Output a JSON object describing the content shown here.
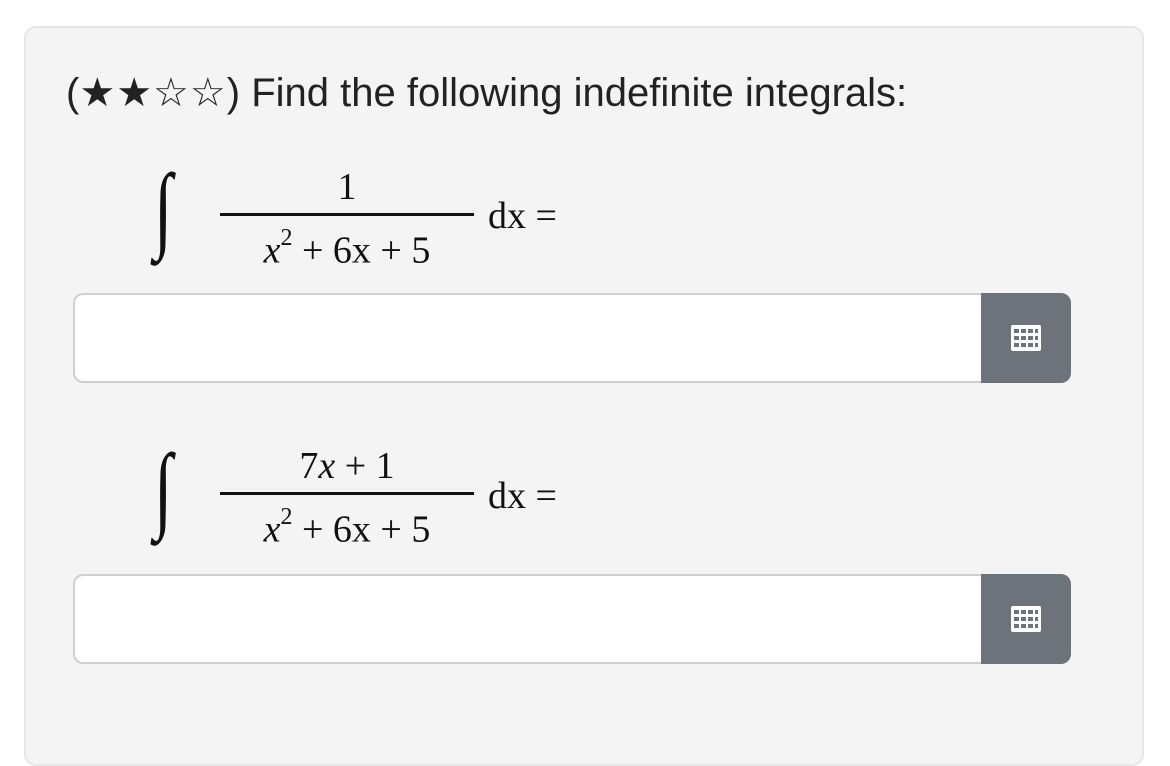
{
  "prompt": {
    "open_paren": "(",
    "stars": "★★☆☆",
    "text": ") Find the following indefinite integrals:"
  },
  "problems": [
    {
      "integral": "∫",
      "numerator": "1",
      "denominator_base": "x",
      "denominator_exp": "2",
      "denominator_rest": " + 6x + 5",
      "differential": "dx =",
      "answer_value": "",
      "keypad_icon": "keyboard-icon"
    },
    {
      "integral": "∫",
      "numerator": "7x + 1",
      "denominator_base": "x",
      "denominator_exp": "2",
      "denominator_rest": " + 6x + 5",
      "differential": "dx =",
      "answer_value": "",
      "keypad_icon": "keyboard-icon"
    }
  ],
  "colors": {
    "card_background": "#f4f4f4",
    "keypad_button": "#6c737a"
  }
}
